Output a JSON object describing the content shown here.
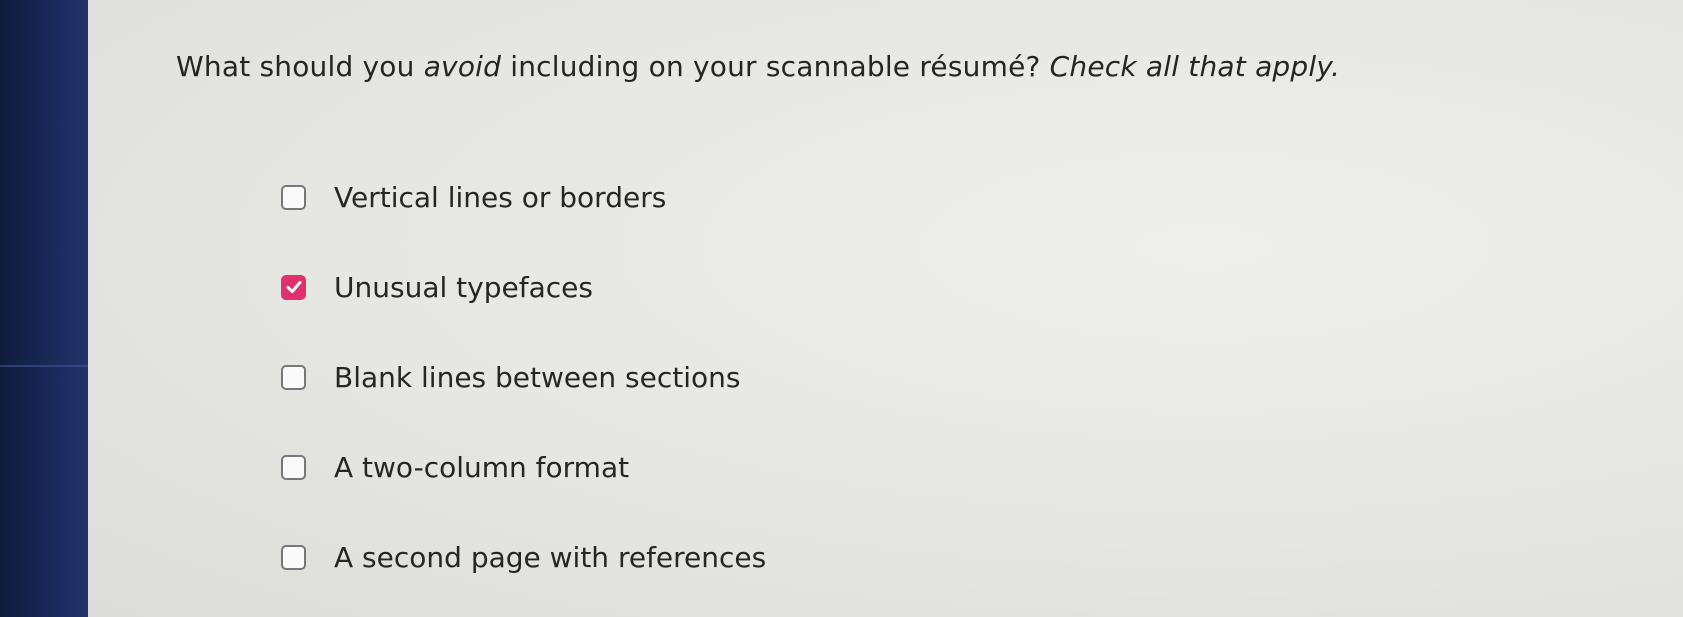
{
  "question": {
    "part1": "What should you ",
    "emphasis": "avoid",
    "part2": " including on your scannable résumé? ",
    "instruction": "Check all that apply."
  },
  "options": [
    {
      "label": "Vertical lines or borders",
      "checked": false
    },
    {
      "label": "Unusual typefaces",
      "checked": true
    },
    {
      "label": "Blank lines between sections",
      "checked": false
    },
    {
      "label": "A two-column format",
      "checked": false
    },
    {
      "label": "A second page with references",
      "checked": false
    }
  ],
  "colors": {
    "checked_fill": "#e0306d",
    "page_background": "#e9e9e6",
    "bezel": "#1a2857"
  },
  "icons": {
    "checked": "checkmark-icon"
  }
}
